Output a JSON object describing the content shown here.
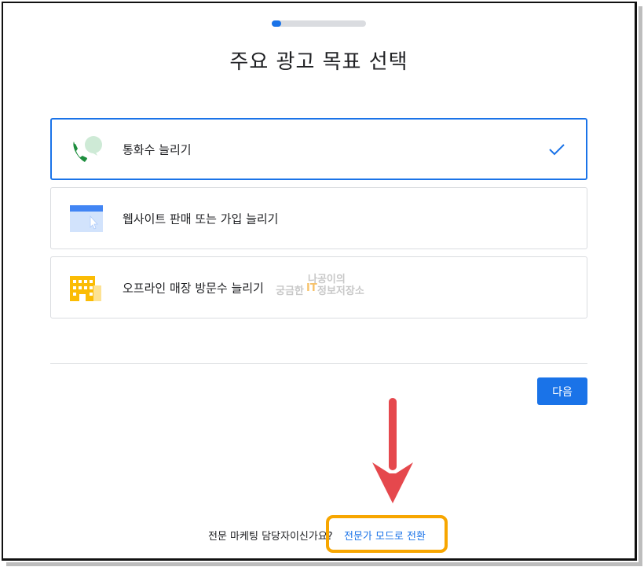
{
  "progress": {
    "fraction": 0.1
  },
  "title": "주요 광고 목표 선택",
  "options": [
    {
      "label": "통화수 늘리기",
      "icon": "phone-chat-icon",
      "selected": true
    },
    {
      "label": "웹사이트 판매 또는 가입 늘리기",
      "icon": "browser-cursor-icon",
      "selected": false
    },
    {
      "label": "오프라인 매장 방문수 늘리기",
      "icon": "building-store-icon",
      "selected": false
    }
  ],
  "watermark": {
    "line1": "나공이의",
    "line2a": "궁금한",
    "line2b": "IT",
    "line2c": "정보저장소"
  },
  "next_button": "다음",
  "footer": {
    "question": "전문 마케팅 담당자이신가요?",
    "link": "전문가 모드로 전환"
  },
  "colors": {
    "accent": "#1a73e8",
    "highlight": "#f7a600",
    "arrow": "#e5484d"
  }
}
